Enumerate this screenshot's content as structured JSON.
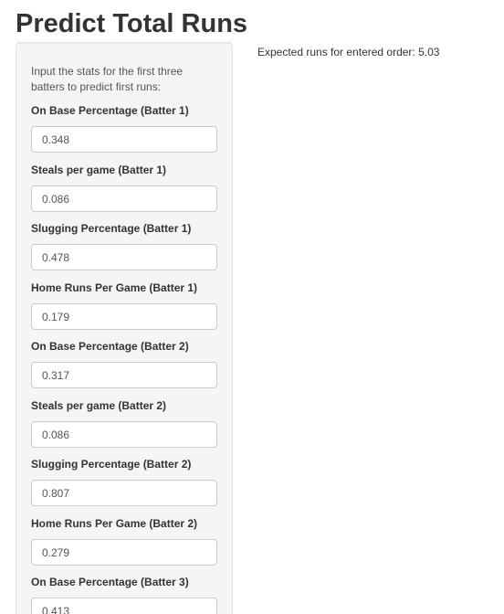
{
  "page": {
    "title": "Predict Total Runs"
  },
  "sidebar": {
    "intro": "Input the stats for the first three batters to predict first runs:",
    "fields": [
      {
        "label": "On Base Percentage (Batter 1)",
        "value": "0.348"
      },
      {
        "label": "Steals per game (Batter 1)",
        "value": "0.086"
      },
      {
        "label": "Slugging Percentage (Batter 1)",
        "value": "0.478"
      },
      {
        "label": "Home Runs Per Game (Batter 1)",
        "value": "0.179"
      },
      {
        "label": "On Base Percentage (Batter 2)",
        "value": "0.317"
      },
      {
        "label": "Steals per game (Batter 2)",
        "value": "0.086"
      },
      {
        "label": "Slugging Percentage (Batter 2)",
        "value": "0.807"
      },
      {
        "label": "Home Runs Per Game (Batter 2)",
        "value": "0.279"
      },
      {
        "label": "On Base Percentage (Batter 3)",
        "value": "0.413"
      }
    ]
  },
  "output": {
    "text": "Expected runs for entered order: 5.03"
  }
}
